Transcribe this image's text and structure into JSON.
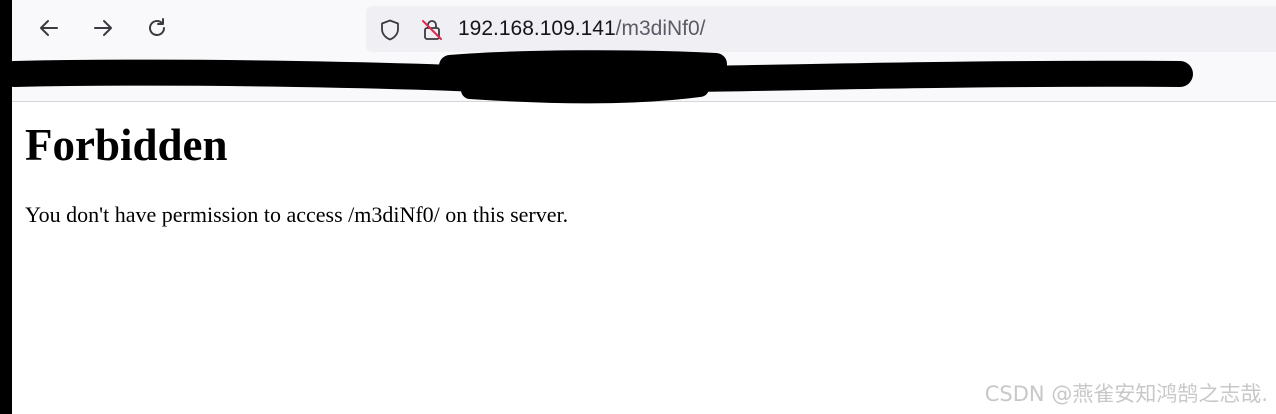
{
  "browser": {
    "address_bar": {
      "host": "192.168.109.141",
      "path": "/m3diNf0/"
    },
    "icons": {
      "back": "back-arrow-icon",
      "forward": "forward-arrow-icon",
      "reload": "reload-icon",
      "tracking_protection": "shield-icon",
      "connection": "insecure-lock-icon"
    }
  },
  "page": {
    "heading": "Forbidden",
    "message": "You don't have permission to access /m3diNf0/ on this server."
  },
  "watermark": "CSDN @燕雀安知鸿鹄之志哉.",
  "colors": {
    "toolbar_bg": "#f9f9fb",
    "url_bar_bg": "#f0f0f4",
    "insecure_accent": "#e22850",
    "redaction": "#000000"
  }
}
